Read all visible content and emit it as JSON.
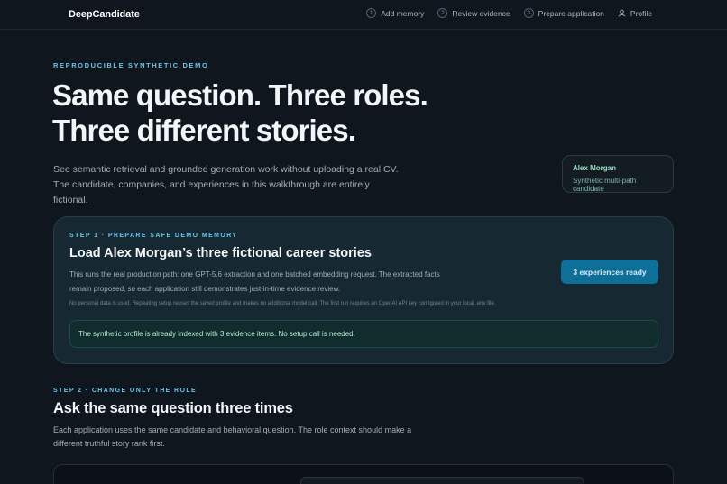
{
  "brand": "DeepCandidate",
  "nav": {
    "items": [
      {
        "num": "1",
        "label": "Add memory"
      },
      {
        "num": "2",
        "label": "Review evidence"
      },
      {
        "num": "3",
        "label": "Prepare application"
      }
    ],
    "profile": "Profile"
  },
  "hero": {
    "eyebrow": "REPRODUCIBLE SYNTHETIC DEMO",
    "title_line1": "Same question. Three roles.",
    "title_line2": "Three different stories.",
    "subtitle": "See semantic retrieval and grounded generation work without uploading a real CV. The candidate, companies, and experiences in this walkthrough are entirely fictional."
  },
  "candidate": {
    "name": "Alex Morgan",
    "description": "Synthetic multi-path candidate"
  },
  "step1": {
    "eyebrow": "STEP 1 · PREPARE SAFE DEMO MEMORY",
    "title": "Load Alex Morgan’s three fictional career stories",
    "body": "This runs the real production path: one GPT-5.6 extraction and one batched embedding request. The extracted facts remain proposed, so each application still demonstrates just-in-time evidence review.",
    "note": "No personal data is used. Repeating setup reuses the saved profile and makes no additional model call. The first run requires an OpenAI API key configured in your local .env file.",
    "button": "3 experiences ready",
    "status": "The synthetic profile is already indexed with 3 evidence items. No setup call is needed."
  },
  "step2": {
    "eyebrow": "STEP 2 · CHANGE ONLY THE ROLE",
    "title": "Ask the same question three times",
    "body": "Each application uses the same candidate and behavioral question. The role context should make a different truthful story rank first."
  }
}
